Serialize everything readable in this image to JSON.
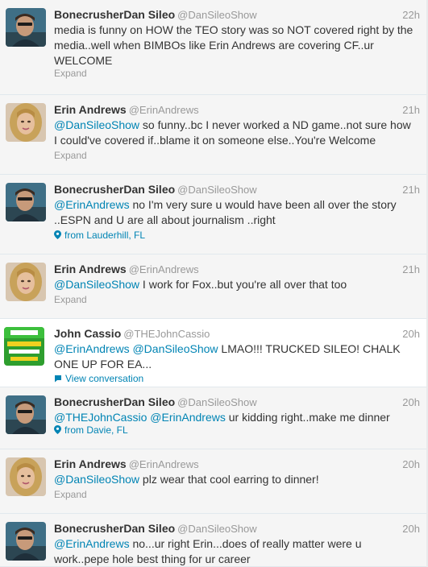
{
  "tweets": [
    {
      "name": "BonecrusherDan Sileo",
      "handle": "@DanSileoShow",
      "time": "22h",
      "avatar": "dan-sileo-avatar-icon",
      "segments": [
        {
          "text": "media is funny on HOW the TEO story was so NOT covered right by the media..well when BIMBOs like Erin Andrews are covering CF..ur WELCOME",
          "mention": false
        }
      ],
      "footer": {
        "type": "expand",
        "label": "Expand"
      }
    },
    {
      "name": "Erin Andrews",
      "handle": "@ErinAndrews",
      "time": "21h",
      "avatar": "erin-andrews-avatar-icon",
      "segments": [
        {
          "text": "@DanSileoShow",
          "mention": true
        },
        {
          "text": " so funny..bc I never worked a ND game..not sure how I could've covered if..blame it on someone else..You're Welcome",
          "mention": false
        }
      ],
      "footer": {
        "type": "expand",
        "label": "Expand"
      }
    },
    {
      "name": "BonecrusherDan Sileo",
      "handle": "@DanSileoShow",
      "time": "21h",
      "avatar": "dan-sileo-avatar-icon",
      "segments": [
        {
          "text": "@ErinAndrews",
          "mention": true
        },
        {
          "text": " no I'm very sure u would have been all over the story ..ESPN and U are all about journalism ..right",
          "mention": false
        }
      ],
      "footer": {
        "type": "location",
        "label": "from Lauderhill, FL",
        "icon": "map-pin-icon"
      }
    },
    {
      "name": "Erin Andrews",
      "handle": "@ErinAndrews",
      "time": "21h",
      "avatar": "erin-andrews-avatar-icon",
      "segments": [
        {
          "text": "@DanSileoShow",
          "mention": true
        },
        {
          "text": " I work for Fox..but you're all over that too",
          "mention": false
        }
      ],
      "footer": {
        "type": "expand",
        "label": "Expand"
      }
    },
    {
      "name": "John Cassio",
      "handle": "@THEJohnCassio",
      "time": "20h",
      "avatar": "john-cassio-avatar-icon",
      "segments": [
        {
          "text": "@ErinAndrews",
          "mention": true
        },
        {
          "text": " ",
          "mention": false
        },
        {
          "text": "@DanSileoShow",
          "mention": true
        },
        {
          "text": " LMAO!!! TRUCKED SILEO! CHALK ONE UP FOR EA...",
          "mention": false
        }
      ],
      "footer": {
        "type": "conversation",
        "label": "View conversation",
        "icon": "speech-bubble-icon"
      }
    },
    {
      "name": "BonecrusherDan Sileo",
      "handle": "@DanSileoShow",
      "time": "20h",
      "avatar": "dan-sileo-avatar-icon",
      "segments": [
        {
          "text": "@THEJohnCassio",
          "mention": true
        },
        {
          "text": " ",
          "mention": false
        },
        {
          "text": "@ErinAndrews",
          "mention": true
        },
        {
          "text": " ur kidding right..make me dinner",
          "mention": false
        }
      ],
      "footer": {
        "type": "location",
        "label": "from Davie, FL",
        "icon": "map-pin-icon"
      }
    },
    {
      "name": "Erin Andrews",
      "handle": "@ErinAndrews",
      "time": "20h",
      "avatar": "erin-andrews-avatar-icon",
      "segments": [
        {
          "text": "@DanSileoShow",
          "mention": true
        },
        {
          "text": " plz wear that cool earring to dinner!",
          "mention": false
        }
      ],
      "footer": {
        "type": "expand",
        "label": "Expand"
      }
    },
    {
      "name": "BonecrusherDan Sileo",
      "handle": "@DanSileoShow",
      "time": "20h",
      "avatar": "dan-sileo-avatar-icon",
      "segments": [
        {
          "text": "@ErinAndrews",
          "mention": true
        },
        {
          "text": " no...ur right Erin...does of really matter were u work..pepe hole best thing for ur career",
          "mention": false
        }
      ],
      "footer": null
    }
  ]
}
